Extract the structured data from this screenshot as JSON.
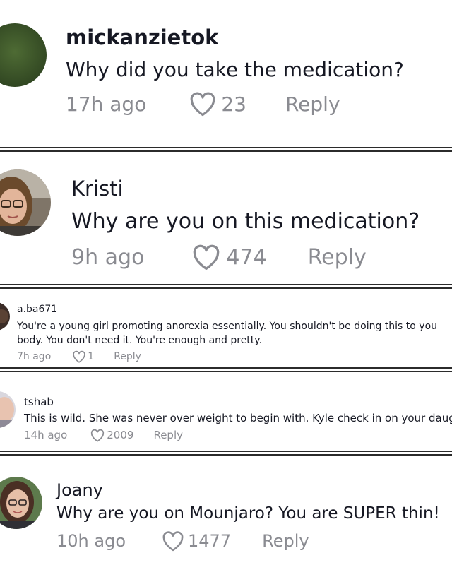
{
  "comments": [
    {
      "username": "mickanzietok",
      "text": "Why did you take the medication?",
      "time": "17h ago",
      "likes": "23",
      "reply": "Reply",
      "avatar_icon": "avatar-dark-green"
    },
    {
      "username": "Kristi",
      "text": "Why are you on this medication?",
      "time": "9h ago",
      "likes": "474",
      "reply": "Reply",
      "avatar_icon": "avatar-photo-woman-glasses"
    },
    {
      "username": "a.ba671",
      "text": "You're a young girl promoting anorexia essentially. You shouldn't be doing this to you",
      "text2": "body. You don't need it. You're enough and pretty.",
      "time": "7h ago",
      "likes": "1",
      "reply": "Reply",
      "avatar_icon": "avatar-dark"
    },
    {
      "username": "tshab",
      "text": "This is wild. She was never over weight to begin with. Kyle check in on your daugh",
      "time": "14h ago",
      "likes": "2009",
      "reply": "Reply",
      "avatar_icon": "avatar-light"
    },
    {
      "username": "Joany",
      "text": "Why are you on Mounjaro? You are SUPER thin!",
      "time": "10h ago",
      "likes": "1477",
      "reply": "Reply",
      "avatar_icon": "avatar-photo-woman-glasses"
    }
  ],
  "icons": {
    "like": "heart-outline-icon"
  },
  "colors": {
    "text": "#161823",
    "meta": "#8a8b91",
    "divider": "#2b2b2b"
  }
}
